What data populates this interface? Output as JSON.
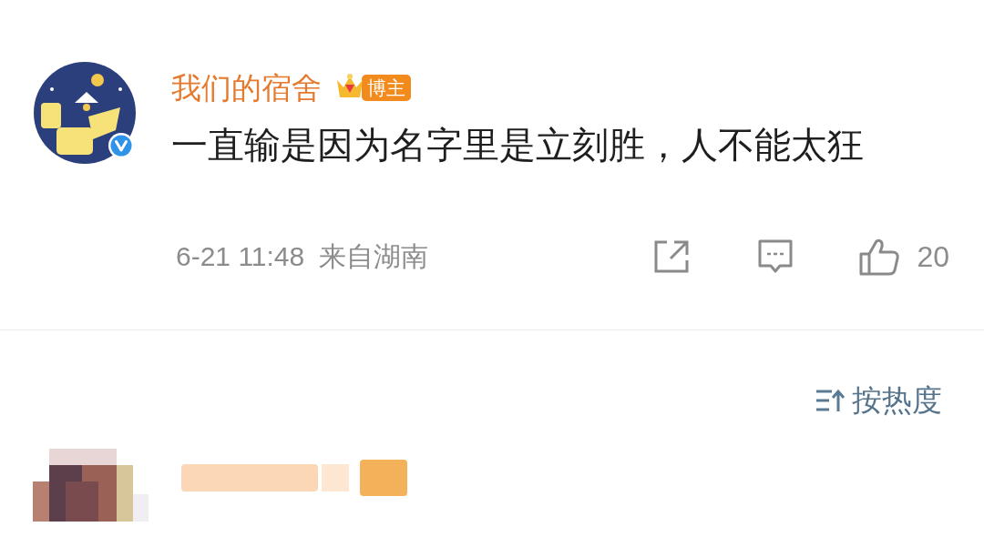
{
  "post": {
    "author": "我们的宿舍",
    "badge": "博主",
    "verified": true,
    "content": "一直输是因为名字里是立刻胜，人不能太狂",
    "time": "6-21 11:48",
    "source": "来自湖南",
    "like_count": "20"
  },
  "comments": {
    "sort_label": "按热度"
  }
}
